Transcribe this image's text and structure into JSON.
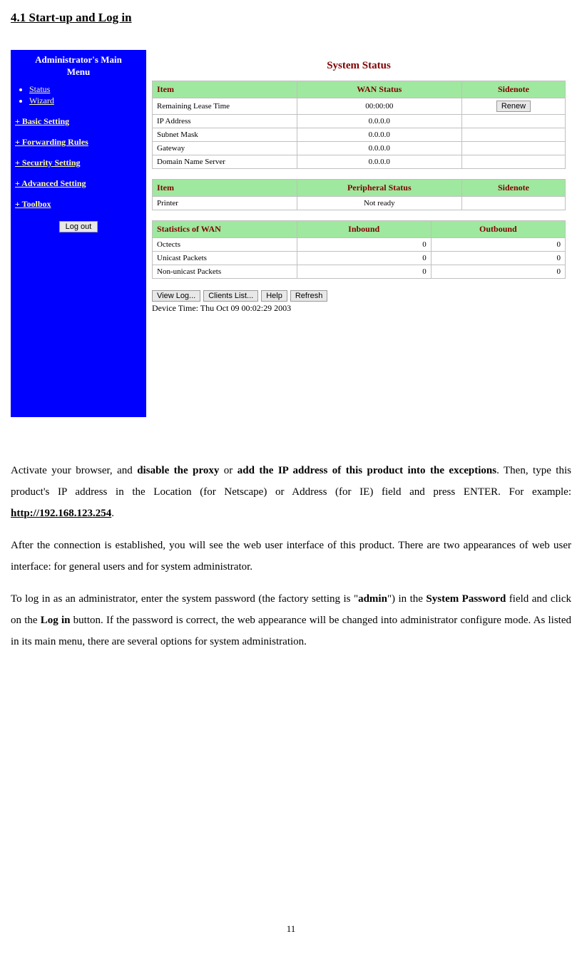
{
  "heading": "4.1 Start-up and Log in",
  "sidebar": {
    "title_line1": "Administrator's Main",
    "title_line2": "Menu",
    "bullets": [
      "Status",
      "Wizard"
    ],
    "links": [
      "+ Basic Setting",
      "+ Forwarding Rules",
      "+ Security Setting",
      "+ Advanced Setting",
      "+ Toolbox"
    ],
    "logout": "Log out"
  },
  "main": {
    "title": "System Status",
    "table1": {
      "headers": [
        "Item",
        "WAN Status",
        "Sidenote"
      ],
      "rows": [
        {
          "item": "Remaining Lease Time",
          "status": "00:00:00",
          "side_button": "Renew"
        },
        {
          "item": "IP Address",
          "status": "0.0.0.0",
          "side": ""
        },
        {
          "item": "Subnet Mask",
          "status": "0.0.0.0",
          "side": ""
        },
        {
          "item": "Gateway",
          "status": "0.0.0.0",
          "side": ""
        },
        {
          "item": "Domain Name Server",
          "status": "0.0.0.0",
          "side": ""
        }
      ]
    },
    "table2": {
      "headers": [
        "Item",
        "Peripheral Status",
        "Sidenote"
      ],
      "rows": [
        {
          "item": "Printer",
          "status": "Not ready",
          "side": ""
        }
      ]
    },
    "table3": {
      "headers": [
        "Statistics of WAN",
        "Inbound",
        "Outbound"
      ],
      "rows": [
        {
          "stat": "Octects",
          "in": "0",
          "out": "0"
        },
        {
          "stat": "Unicast Packets",
          "in": "0",
          "out": "0"
        },
        {
          "stat": "Non-unicast Packets",
          "in": "0",
          "out": "0"
        }
      ]
    },
    "buttons": [
      "View Log...",
      "Clients List...",
      "Help",
      "Refresh"
    ],
    "device_time": "Device Time: Thu Oct 09 00:02:29 2003"
  },
  "paragraphs": {
    "p1_a": "Activate your browser, and ",
    "p1_b": "disable the proxy",
    "p1_c": " or ",
    "p1_d": "add the IP address of this product into the exceptions",
    "p1_e": ". Then, type this product's IP address in the Location (for Netscape) or Address (for IE) field and press ENTER. For example: ",
    "p1_f": "http://192.168.123.254",
    "p1_g": ".",
    "p2": "After the connection is established, you will see the web user interface of this product. There are two appearances of web user interface: for general users and for system administrator.",
    "p3_a": "To log in as an administrator, enter the system password (the factory setting is  \"",
    "p3_b": "admin",
    "p3_c": "\") in the ",
    "p3_d": "System Password",
    "p3_e": " field and click on the ",
    "p3_f": "Log in",
    "p3_g": " button. If the password is correct, the web appearance will be changed into administrator configure mode. As listed in its main menu, there are several options for system administration."
  },
  "page_number": "11"
}
